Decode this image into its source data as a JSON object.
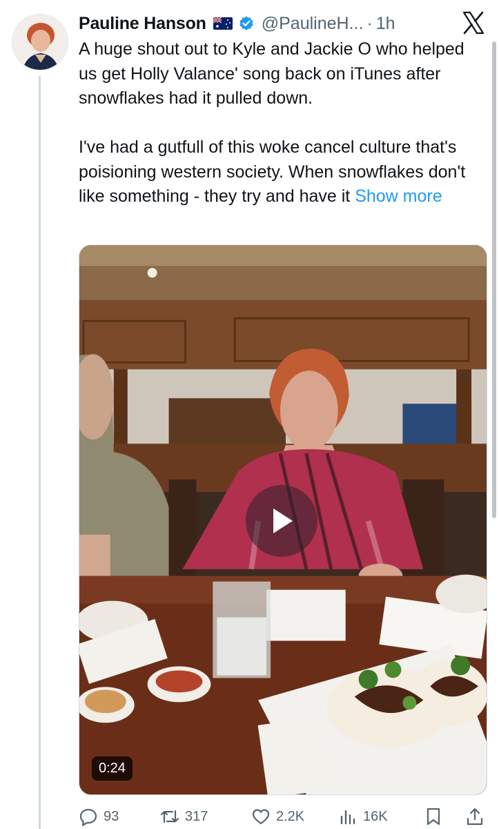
{
  "author": {
    "name": "Pauline Hanson",
    "flag_icon": "australia-flag-icon",
    "verified_icon": "verified-badge-icon",
    "handle": "@PaulineH...",
    "separator": "·",
    "time": "1h"
  },
  "tweet": {
    "paragraph1": "A huge shout out to Kyle and Jackie O who helped us get Holly Valance' song back on iTunes after snowflakes had it pulled down.",
    "paragraph2": "I've had a gutfull of this woke cancel culture that's poisioning western society. When snowflakes don't like something - they try and have it",
    "show_more": "Show more"
  },
  "media": {
    "duration": "0:24",
    "play_icon": "play-icon"
  },
  "actions": {
    "replies": "93",
    "reposts": "317",
    "likes": "2.2K",
    "views": "16K"
  },
  "colors": {
    "link": "#1d9bf0",
    "secondary_text": "#536471",
    "verified": "#1d9bf0"
  }
}
